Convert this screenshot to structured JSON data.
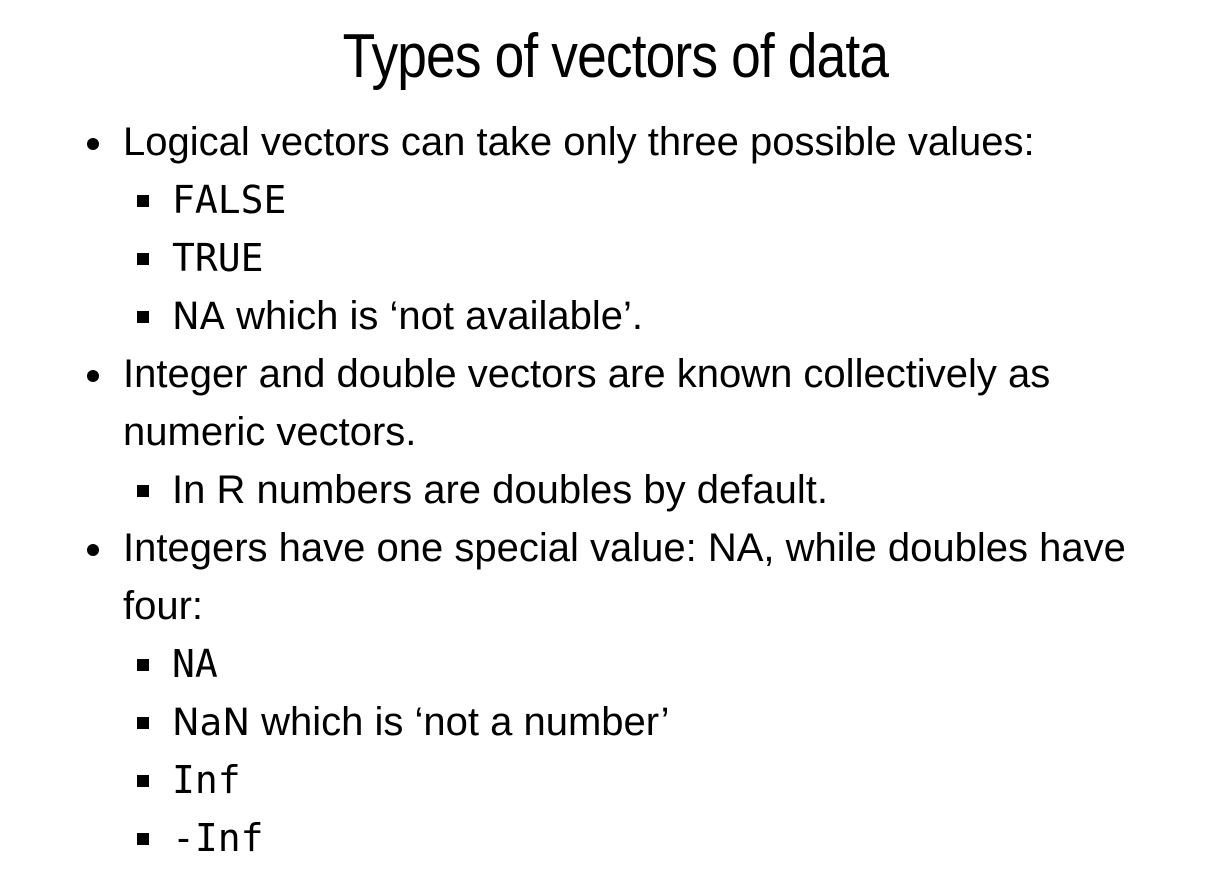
{
  "slide": {
    "title": "Types of vectors of data",
    "bullets": [
      {
        "text": "Logical vectors can take only three possible values:",
        "sub": [
          {
            "code": "FALSE",
            "rest": ""
          },
          {
            "code": "TRUE",
            "rest": ""
          },
          {
            "code": "NA",
            "rest": " which is ‘not available’."
          }
        ]
      },
      {
        "text_line1": "Integer and double vectors are known collectively as",
        "text_line2": "numeric vectors.",
        "sub": [
          {
            "text": "In R numbers are doubles by default."
          }
        ]
      },
      {
        "text_line1": "Integers have one special value: NA, while doubles have",
        "text_line2": "four:",
        "sub": [
          {
            "code": "NA",
            "rest": ""
          },
          {
            "code": "NaN",
            "rest": " which is ‘not a number’"
          },
          {
            "code": "Inf",
            "rest": ""
          },
          {
            "code": "-Inf",
            "rest": ""
          }
        ]
      }
    ]
  }
}
